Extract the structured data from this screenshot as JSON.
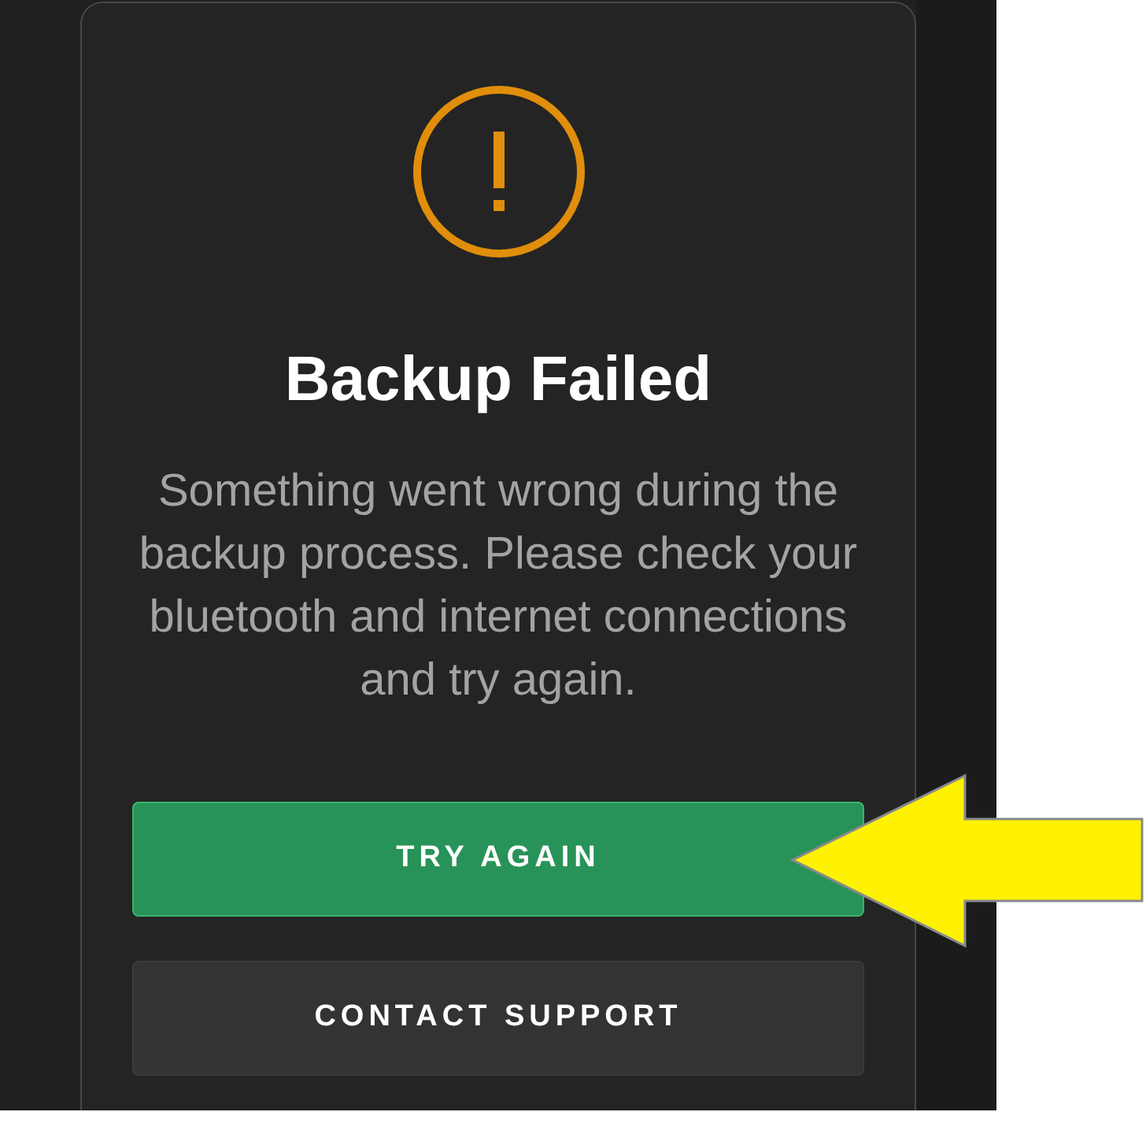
{
  "dialog": {
    "title": "Backup Failed",
    "message": "Something went wrong during the backup process. Please check your bluetooth and internet connections and try again.",
    "buttons": [
      {
        "label": "TRY AGAIN",
        "kind": "primary"
      },
      {
        "label": "CONTACT SUPPORT",
        "kind": "secondary"
      }
    ]
  }
}
